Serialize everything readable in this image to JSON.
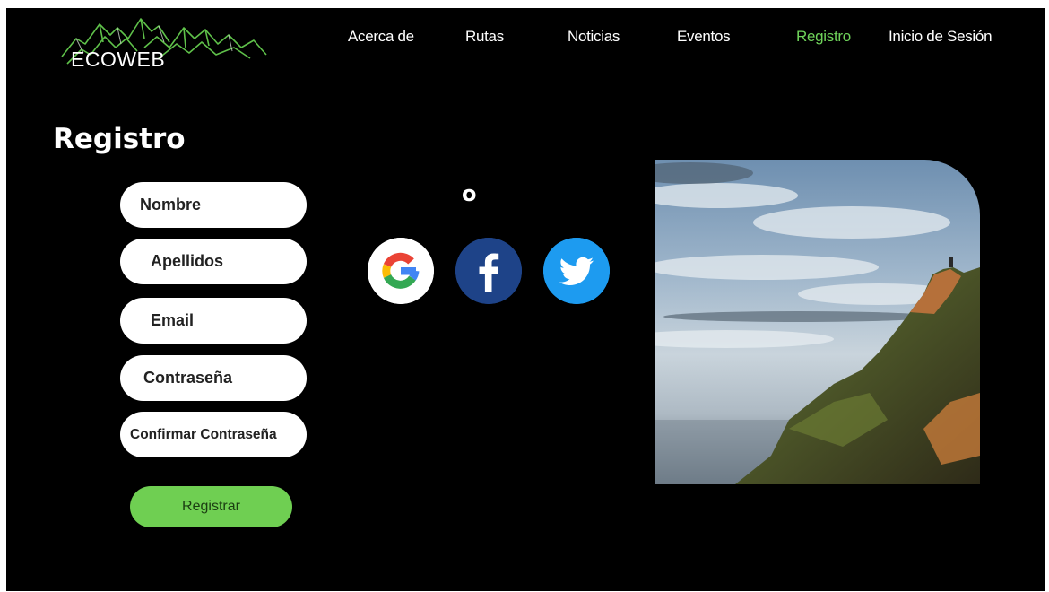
{
  "brand": {
    "name": "ECOWEB"
  },
  "nav": {
    "items": [
      {
        "label": "Acerca de"
      },
      {
        "label": "Rutas"
      },
      {
        "label": "Noticias"
      },
      {
        "label": "Eventos"
      },
      {
        "label": "Registro",
        "active": true
      },
      {
        "label": "Inicio de Sesión"
      }
    ]
  },
  "page": {
    "title": "Registro"
  },
  "form": {
    "nombre_placeholder": "Nombre",
    "apellidos_placeholder": "Apellidos",
    "email_placeholder": "Email",
    "password_placeholder": "Contraseña",
    "confirm_placeholder": "Confirmar Contraseña",
    "submit_label": "Registrar"
  },
  "social": {
    "separator": "o",
    "providers": [
      "google-icon",
      "facebook-icon",
      "twitter-icon"
    ]
  },
  "colors": {
    "background": "#000000",
    "accent": "#6fd35a",
    "button": "#6fcf52",
    "facebook": "#1e4388",
    "twitter": "#1d9bf0"
  }
}
